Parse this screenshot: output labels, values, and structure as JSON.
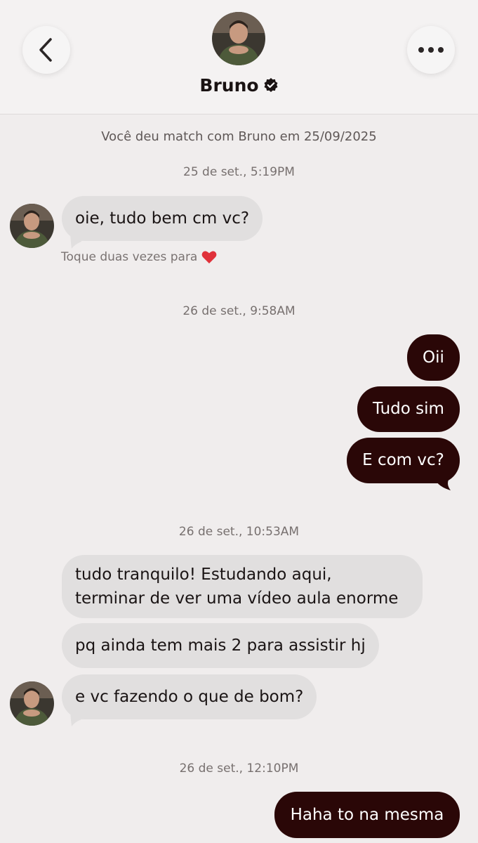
{
  "header": {
    "name": "Bruno",
    "verified_icon": "verified-badge-icon",
    "back_icon": "chevron-left-icon",
    "more_icon": "more-dots-icon"
  },
  "conversation": {
    "match_info": "Você deu match com Bruno em 25/09/2025",
    "timestamps": [
      "25 de set., 5:19PM",
      "26 de set., 9:58AM",
      "26 de set., 10:53AM",
      "26 de set., 12:10PM"
    ],
    "double_tap_hint": "Toque duas vezes para",
    "messages": [
      {
        "from": "them",
        "text": "oie, tudo bem cm vc?"
      },
      {
        "from": "me",
        "text": "Oii"
      },
      {
        "from": "me",
        "text": "Tudo sim"
      },
      {
        "from": "me",
        "text": "E com vc?"
      },
      {
        "from": "them",
        "lines": [
          "tudo tranquilo! Estudando aqui,",
          "terminar de ver uma vídeo aula enorme"
        ]
      },
      {
        "from": "them",
        "text": "pq ainda tem mais 2 para assistir hj"
      },
      {
        "from": "them",
        "text": "e vc fazendo o que de bom?"
      },
      {
        "from": "me",
        "text": "Haha to na mesma"
      }
    ]
  },
  "colors": {
    "background": "#f0eded",
    "incoming_bubble": "#e1dfdf",
    "outgoing_bubble": "#2a0707",
    "heart": "#e0313a"
  }
}
